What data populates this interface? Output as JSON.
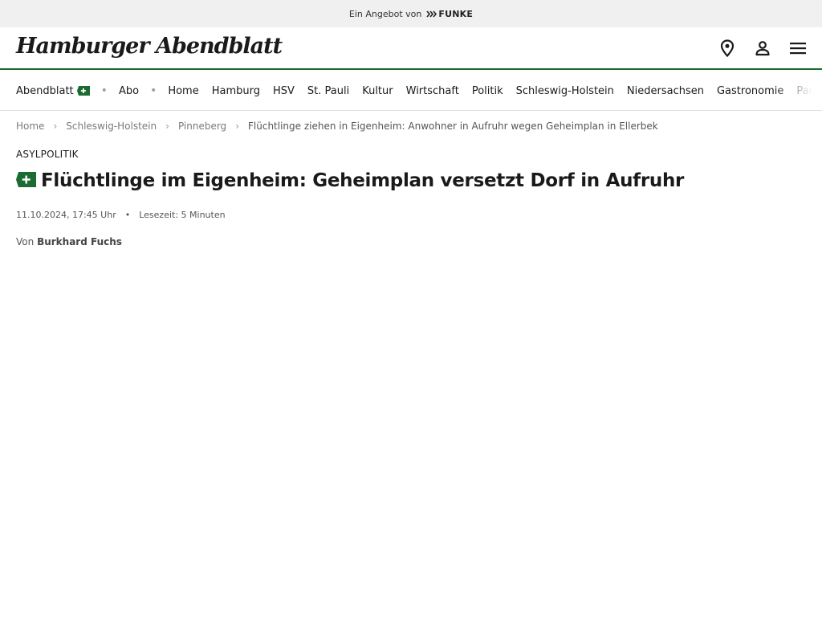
{
  "topbar": {
    "offer_text": "Ein Angebot von",
    "brand": "FUNKE"
  },
  "header": {
    "logo_text": "Hamburger Abendblatt",
    "icons": [
      "location-pin-icon",
      "user-icon",
      "menu-icon"
    ]
  },
  "nav": {
    "brand_item": "Abendblatt",
    "abo": "Abo",
    "items": [
      "Home",
      "Hamburg",
      "HSV",
      "St. Pauli",
      "Kultur",
      "Wirtschaft",
      "Politik",
      "Schleswig-Holstein",
      "Niedersachsen",
      "Gastronomie",
      "Panorama"
    ]
  },
  "breadcrumb": {
    "items": [
      "Home",
      "Schleswig-Holstein",
      "Pinneberg"
    ],
    "current": "Flüchtlinge ziehen in Eigenheim: Anwohner in Aufruhr wegen Geheimplan in Ellerbek"
  },
  "article": {
    "kicker": "ASYLPOLITIK",
    "title": "Flüchtlinge im Eigenheim: Geheimplan versetzt Dorf in Aufruhr",
    "date": "11.10.2024, 17:45 Uhr",
    "reading_time": "Lesezeit: 5 Minuten",
    "author_prefix": "Von",
    "author": "Burkhard Fuchs"
  },
  "colors": {
    "accent_green": "#1b6b32",
    "topbar_bg": "#f0f0f0"
  }
}
